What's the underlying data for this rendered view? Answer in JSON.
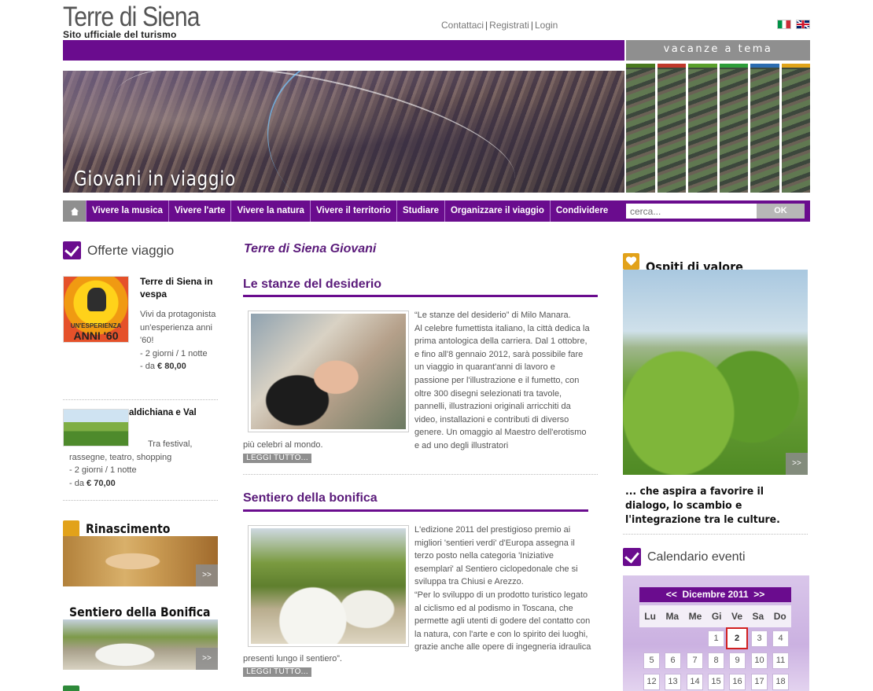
{
  "header": {
    "logo_title": "Terre di Siena",
    "logo_subtitle": "Sito ufficiale del turismo",
    "links": [
      "Contattaci",
      "Registrati",
      "Login"
    ],
    "languages": [
      "it",
      "en"
    ],
    "themes_label": "vacanze a tema",
    "theme_strip_colors": [
      "#4a7a1f",
      "#c0392b",
      "#5aa02c",
      "#2e9e3a",
      "#2b6cb0",
      "#e0a41a"
    ]
  },
  "hero": {
    "caption": "Giovani in viaggio"
  },
  "nav": {
    "items": [
      "Vivere la musica",
      "Vivere l'arte",
      "Vivere la natura",
      "Vivere il territorio",
      "Studiare",
      "Organizzare il viaggio",
      "Condividere"
    ],
    "search_placeholder": "cerca...",
    "ok_label": "OK"
  },
  "offers": {
    "heading": "Offerte viaggio",
    "offer1": {
      "image_line1": "UN'ESPERIENZA",
      "image_line2": "ANNI '60",
      "title": "Terre di Siena in vespa",
      "description": "Vivi da protagonista un'esperienza anni '60!",
      "duration": "- 2 giorni / 1 notte",
      "price_prefix": "- da",
      "price": "€ 80,00"
    },
    "offer2": {
      "title": "aldichiana e Val",
      "description_line1": "Tra festival,",
      "description_line2": "rassegne, teatro, shopping",
      "duration": "- 2 giorni / 1 notte",
      "price_prefix": "- da",
      "price": "€ 70,00"
    }
  },
  "themes": [
    {
      "title": "Rinascimento",
      "arrow": ">>",
      "color": "#e2a21a"
    },
    {
      "title": "Sentiero della Bonifica",
      "arrow": ">>",
      "color": "#b04a6a"
    }
  ],
  "main": {
    "title": "Terre di Siena Giovani",
    "articles": [
      {
        "heading": "Le stanze del desiderio",
        "paragraphs": [
          "“Le stanze del desiderio” di Milo Manara.",
          "Al celebre fumettista italiano, la città dedica la prima antologica della carriera. Dal 1 ottobre, e fino all'8 gennaio 2012, sarà possibile fare un viaggio in quarant'anni di lavoro e passione per l'illustrazione e il fumetto, con oltre 300 disegni selezionati tra tavole, pannelli, illustrazioni originali arricchiti da video, installazioni e contributi di diverso genere. Un omaggio al Maestro dell'erotismo e ad uno degli illustratori"
        ],
        "tail": "più celebri al mondo.",
        "read_more": "LEGGI TUTTO..."
      },
      {
        "heading": "Sentiero della bonifica",
        "paragraphs": [
          "L'edizione 2011 del prestigioso premio ai migliori 'sentieri verdi' d'Europa assegna il terzo posto nella categoria 'Iniziative esemplari' al Sentiero ciclopedonale che si sviluppa tra Chiusi e Arezzo.",
          "“Per lo sviluppo di un prodotto turistico legato al ciclismo ed al podismo in Toscana, che permette agli utenti di godere del contatto con la natura, con l'arte e con lo spirito dei luoghi, grazie anche alle opere di ingegneria idraulica"
        ],
        "tail": "presenti lungo il sentiero”.",
        "read_more": "LEGGI TUTTO..."
      }
    ]
  },
  "guests": {
    "heading": "Ospiti di valore",
    "arrow": ">>",
    "caption": "... che aspira a favorire il dialogo, lo scambio e l'integrazione tra le culture."
  },
  "calendar": {
    "heading": "Calendario eventi",
    "prev": "<<",
    "month": "Dicembre 2011",
    "next": ">>",
    "weekdays": [
      "Lu",
      "Ma",
      "Me",
      "Gi",
      "Ve",
      "Sa",
      "Do"
    ],
    "days": [
      "1",
      "2",
      "3",
      "4",
      "5",
      "6",
      "7",
      "8",
      "9",
      "10",
      "11",
      "12",
      "13",
      "14",
      "15",
      "16",
      "17",
      "18"
    ],
    "selected_day": "2"
  }
}
